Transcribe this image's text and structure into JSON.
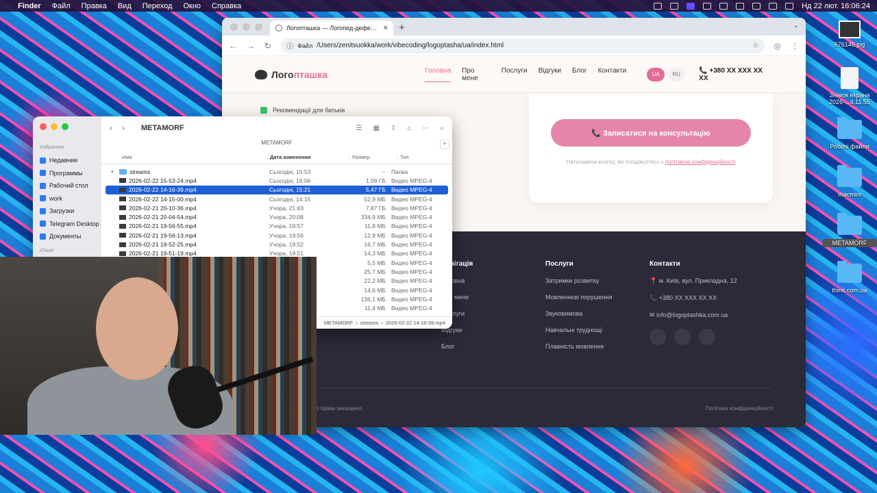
{
  "menubar": {
    "app": "Finder",
    "items": [
      "Файл",
      "Правка",
      "Вид",
      "Переход",
      "Окно",
      "Справка"
    ],
    "clock": "Нд 22 лют.  16:06:24"
  },
  "desktop": {
    "icons": [
      {
        "label": "676146.jpg",
        "kind": "image"
      },
      {
        "label": "Знімок екрана 2026-...4.11.55",
        "kind": "doc"
      },
      {
        "label": "Робочі файли",
        "kind": "folder"
      },
      {
        "label": "macmini",
        "kind": "folder"
      },
      {
        "label": "METAMORF",
        "kind": "folder"
      },
      {
        "label": "think.com.ua",
        "kind": "folder"
      }
    ]
  },
  "browser": {
    "tab_title": "Логопташка — Логопед-дефектолог",
    "tab_close": "×",
    "new_tab": "+",
    "url_scheme": "Файл",
    "url": "/Users/zenitsuokka/work/vibecoding/logoptasha/ua/index.html"
  },
  "site": {
    "logo_part1": "Лого",
    "logo_part2": "пташка",
    "nav": [
      "Головна",
      "Про мене",
      "Послуги",
      "Відгуки",
      "Блог",
      "Контакти"
    ],
    "lang_ua": "UA",
    "lang_ru": "RU",
    "phone": "📞 +380 XX XXX XX XX",
    "recommend": "Рекомендації для батьків",
    "cta": "📞 Записатися на консультацію",
    "consent_text": "Натискаючи кнопку, ви погоджуєтесь з ",
    "consent_link": "політикою конфіденційності",
    "footer": {
      "nav_title": "Навігація",
      "nav_items": [
        "Головна",
        "Про мене",
        "Послуги",
        "Відгуки",
        "Блог"
      ],
      "services_title": "Послуги",
      "services_items": [
        "Затримки розвитку",
        "Мовленнєві порушення",
        "Звуковимова",
        "Навчальні труднощі",
        "Плавність мовлення"
      ],
      "contacts_title": "Контакти",
      "address": "м. Київ, вул. Прикладна, 12",
      "phone": "+380 XX XXX XX XX",
      "email": "info@logoptashka.com.ua",
      "rights": "Всі права захищено.",
      "privacy": "Політика конфіденційності"
    }
  },
  "finder": {
    "title": "METAMORF",
    "path_title": "METAMORF",
    "sidebar_section": "Избранное",
    "sidebar_section2": "iCloud",
    "sidebar_items": [
      "Недавние",
      "Программы",
      "Рабочий стол",
      "work",
      "Загрузки",
      "Telegram Desktop",
      "Документы"
    ],
    "columns": {
      "name": "Имя",
      "date": "Дата изменения",
      "size": "Размер",
      "type": "Тип"
    },
    "rows": [
      {
        "name": "streams",
        "date": "Сьогодні, 15:53",
        "size": "--",
        "type": "Папка",
        "folder": true
      },
      {
        "name": "2026-02-22 15-53-24.mp4",
        "date": "Сьогодні, 16:06",
        "size": "1,09 ГБ",
        "type": "Видео MPEG-4"
      },
      {
        "name": "2026-02-22 14-16-39.mp4",
        "date": "Сьогодні, 15:21",
        "size": "5,47 ГБ",
        "type": "Видео MPEG-4",
        "selected": true
      },
      {
        "name": "2026-02-22 14-15-00.mp4",
        "date": "Сьогодні, 14:15",
        "size": "52,9 МБ",
        "type": "Видео MPEG-4"
      },
      {
        "name": "2026-02-21 20-10-36.mp4",
        "date": "Учора, 21:43",
        "size": "7,87 ГБ",
        "type": "Видео MPEG-4"
      },
      {
        "name": "2026-02-21 20-04-54.mp4",
        "date": "Учора, 20:08",
        "size": "334,9 МБ",
        "type": "Видео MPEG-4"
      },
      {
        "name": "2026-02-21 19-56-55.mp4",
        "date": "Учора, 19:57",
        "size": "11,8 МБ",
        "type": "Видео MPEG-4"
      },
      {
        "name": "2026-02-21 19-56-13.mp4",
        "date": "Учора, 19:56",
        "size": "12,9 МБ",
        "type": "Видео MPEG-4"
      },
      {
        "name": "2026-02-21 19-52-25.mp4",
        "date": "Учора, 19:52",
        "size": "16,7 МБ",
        "type": "Видео MPEG-4"
      },
      {
        "name": "2026-02-21 19-51-19.mp4",
        "date": "Учора, 19:51",
        "size": "14,3 МБ",
        "type": "Видео MPEG-4"
      },
      {
        "name": "",
        "date": "",
        "size": "5,5 МБ",
        "type": "Видео MPEG-4"
      },
      {
        "name": "",
        "date": "",
        "size": "25,7 МБ",
        "type": "Видео MPEG-4"
      },
      {
        "name": "",
        "date": "",
        "size": "22,2 МБ",
        "type": "Видео MPEG-4"
      },
      {
        "name": "",
        "date": "",
        "size": "14,6 МБ",
        "type": "Видео MPEG-4"
      },
      {
        "name": "",
        "date": "",
        "size": "136,1 МБ",
        "type": "Видео MPEG-4"
      },
      {
        "name": "",
        "date": "",
        "size": "11,4 МБ",
        "type": "Видео MPEG-4"
      }
    ],
    "pathbar": [
      "METAMORF",
      "streams",
      "2026-02-22 14-16-39.mp4"
    ]
  }
}
